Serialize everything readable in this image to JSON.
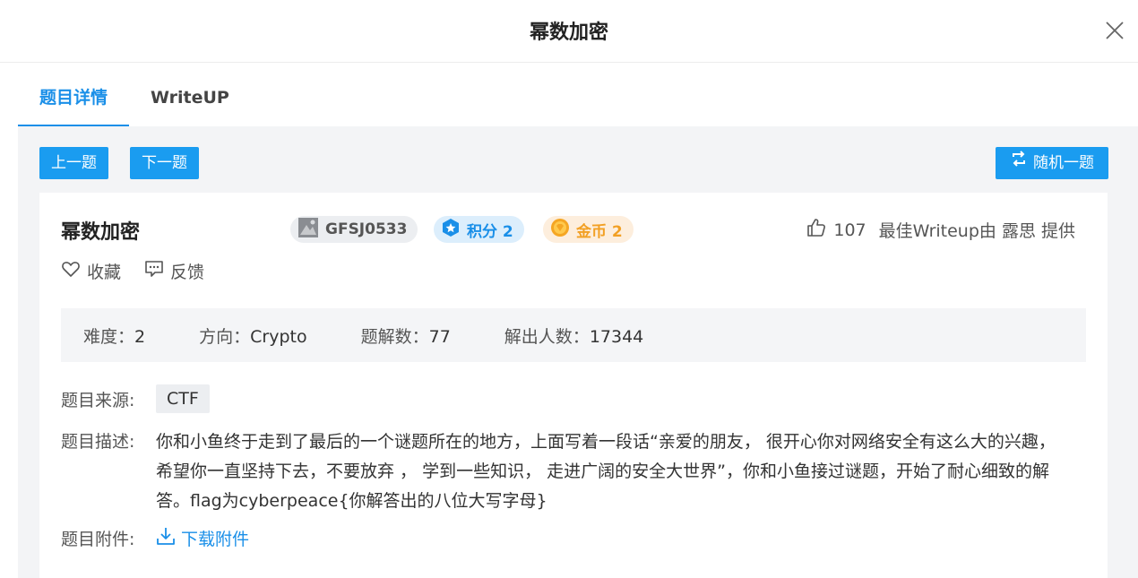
{
  "modal": {
    "title": "幂数加密"
  },
  "tabs": [
    {
      "label": "题目详情",
      "active": true
    },
    {
      "label": "WriteUP",
      "active": false
    }
  ],
  "toolbar": {
    "prev_label": "上一题",
    "next_label": "下一题",
    "random_label": "随机一题"
  },
  "challenge": {
    "title": "幂数加密",
    "id": "GFSJ0533",
    "points": "积分 2",
    "gold": "金币 2",
    "likes": "107",
    "best_writeup": "最佳Writeup由 露思 提供",
    "favorite_label": "收藏",
    "feedback_label": "反馈"
  },
  "stats": {
    "difficulty_label": "难度：",
    "difficulty": "2",
    "direction_label": "方向：",
    "direction": "Crypto",
    "solves_label": "题解数：",
    "solves": "77",
    "solvers_label": "解出人数：",
    "solvers": "17344"
  },
  "details": {
    "source_label": "题目来源:",
    "source": "CTF",
    "desc_label": "题目描述:",
    "description": "你和小鱼终于走到了最后的一个谜题所在的地方，上面写着一段话“亲爱的朋友， 很开心你对网络安全有这么大的兴趣，希望你一直坚持下去，不要放弃 ， 学到一些知识， 走进广阔的安全大世界”，你和小鱼接过谜题，开始了耐心细致的解答。flag为cyberpeace{你解答出的八位大写字母}",
    "attach_label": "题目附件:",
    "download_label": "下载附件"
  },
  "colors": {
    "accent": "#1a8fe8",
    "button": "#1a9cf0",
    "gold": "#f2a024",
    "panel": "#f3f4f6"
  }
}
